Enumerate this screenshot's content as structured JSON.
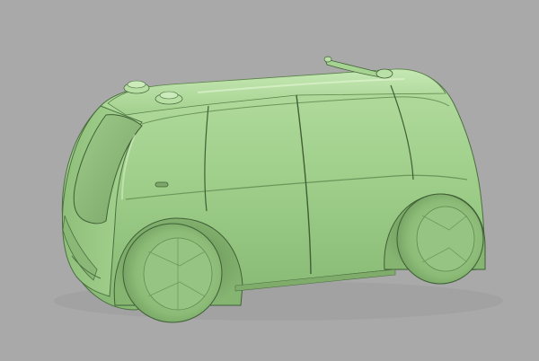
{
  "viewport": {
    "background": "#a9a9a9"
  },
  "model": {
    "subject": "autonomous-shuttle-van-3d-render",
    "colors": {
      "body_light": "#b4dca0",
      "body_mid": "#98c984",
      "body_dark": "#6f9f5e",
      "body_shadow": "#557f47",
      "edge_line": "#3f5f35",
      "wheel_face": "#8dbd78",
      "wheel_shade": "#6e9c5d",
      "glass": "#7fa86d",
      "highlight": "#d7f0c7"
    }
  }
}
